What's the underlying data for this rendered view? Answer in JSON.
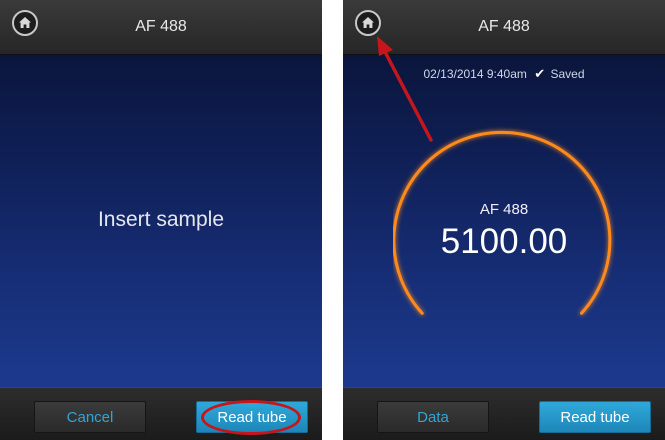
{
  "left_screen": {
    "title": "AF 488",
    "message": "Insert sample",
    "buttons": {
      "cancel": "Cancel",
      "read": "Read tube"
    }
  },
  "right_screen": {
    "title": "AF 488",
    "timestamp": "02/13/2014 9:40am",
    "saved_label": "Saved",
    "gauge": {
      "label": "AF 488",
      "value": "5100.00"
    },
    "buttons": {
      "data": "Data",
      "read": "Read tube"
    }
  },
  "colors": {
    "gauge_arc": "#f59a2a",
    "accent_blue": "#2fa9da",
    "annotation_red": "#c4161c"
  }
}
